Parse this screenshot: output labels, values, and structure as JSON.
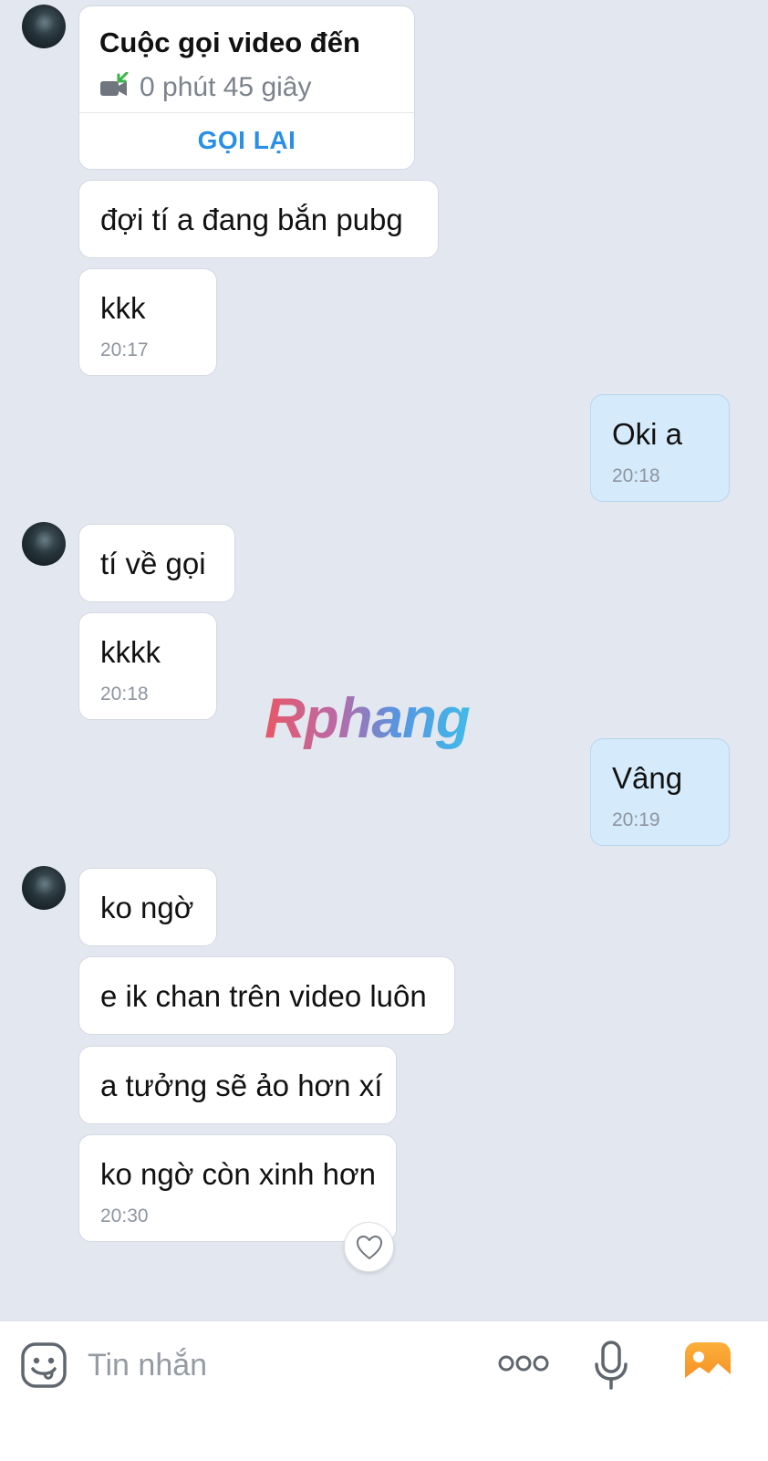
{
  "messages": {
    "call": {
      "title": "Cuộc gọi video đến",
      "duration": "0 phút 45 giây",
      "callback_label": "GỌI LẠI"
    },
    "m1": {
      "text": "đợi tí a đang bắn pubg"
    },
    "m2": {
      "text": "kkk",
      "time": "20:17"
    },
    "m3": {
      "text": "Oki a",
      "time": "20:18"
    },
    "m4": {
      "text": "tí về gọi"
    },
    "m5": {
      "text": "kkkk",
      "time": "20:18"
    },
    "m6": {
      "text": "Vâng",
      "time": "20:19"
    },
    "m7": {
      "text": "ko ngờ"
    },
    "m8": {
      "text": "e ik chan trên video luôn"
    },
    "m9": {
      "text": "a tưởng sẽ ảo hơn xí"
    },
    "m10": {
      "text": "ko ngờ còn xinh hơn",
      "time": "20:30"
    }
  },
  "watermark": {
    "text": "Rphang"
  },
  "input_bar": {
    "placeholder": "Tin nhắn",
    "icons": [
      "emoji-icon",
      "more-icon",
      "microphone-icon",
      "image-icon"
    ]
  },
  "colors": {
    "accent": "#2a8fe6",
    "my_bubble": "#d5eafa",
    "their_bubble": "#ffffff",
    "background": "#e3e7ef"
  }
}
